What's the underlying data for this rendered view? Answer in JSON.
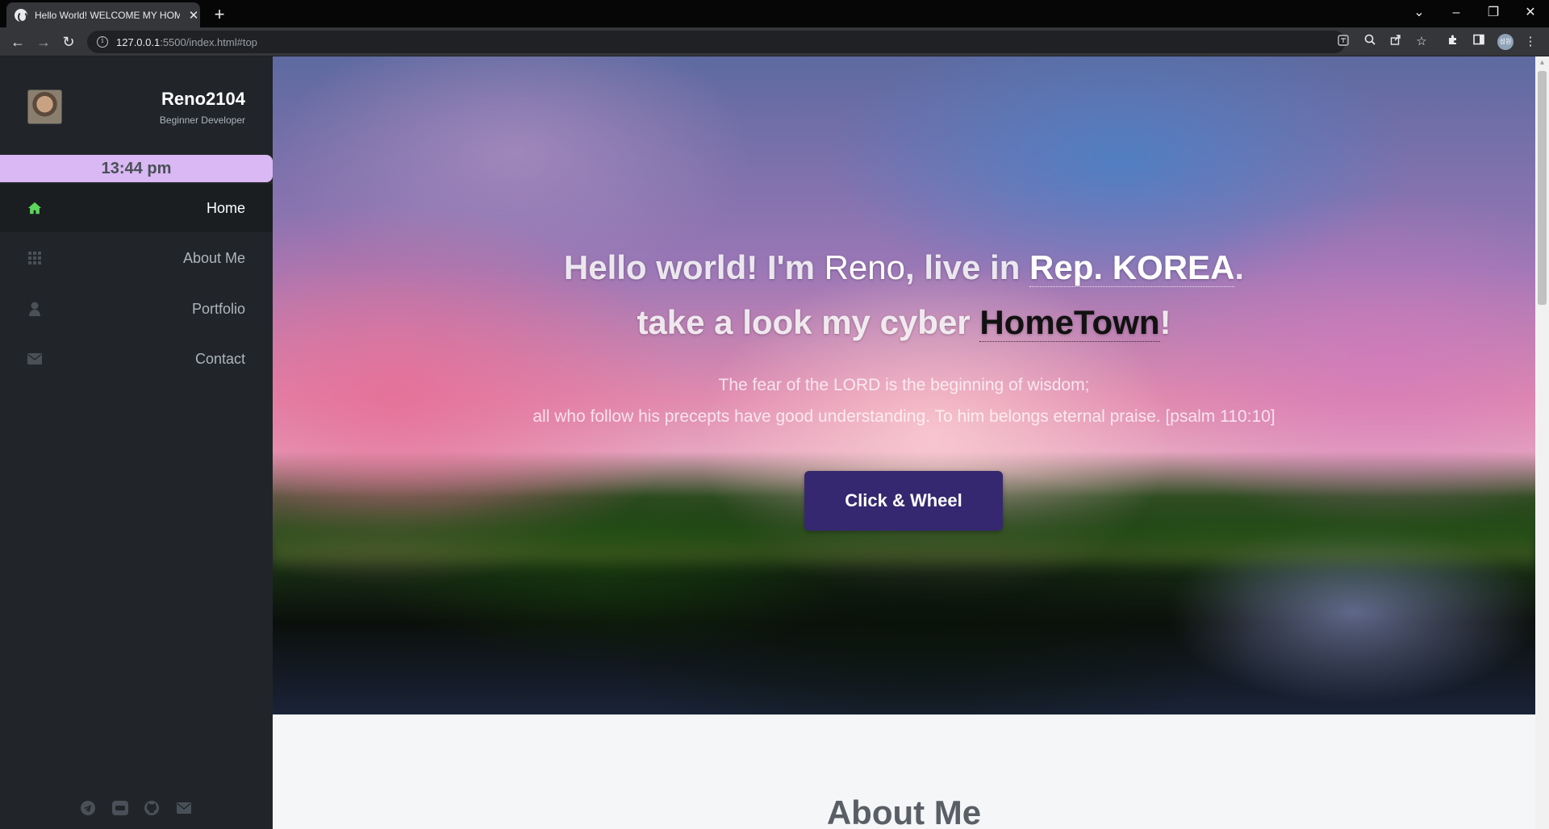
{
  "browser": {
    "tab_title": "Hello World! WELCOME MY HOME",
    "tab_close": "✕",
    "new_tab": "+",
    "url_host": "127.0.0.1",
    "url_rest": ":5500/index.html#top",
    "profile_initials": "성원"
  },
  "sidebar": {
    "name": "Reno2104",
    "role": "Beginner Developer",
    "clock": "13:44 pm",
    "menu": [
      {
        "label": "Home",
        "icon": "home-icon",
        "active": true
      },
      {
        "label": "About Me",
        "icon": "grid-icon",
        "active": false
      },
      {
        "label": "Portfolio",
        "icon": "user-icon",
        "active": false
      },
      {
        "label": "Contact",
        "icon": "envelope-icon",
        "active": false
      }
    ],
    "social": [
      "telegram-icon",
      "chat-icon",
      "github-icon",
      "mail-icon"
    ]
  },
  "hero": {
    "line1_a": "Hello world! I'm ",
    "line1_name": "Reno",
    "line1_b": ", live in ",
    "line1_country": "Rep. KOREA",
    "line1_c": ".",
    "line2_a": "take a look my cyber ",
    "line2_kw": "HomeTown",
    "line2_b": "!",
    "verse1": "The fear of the LORD is the beginning of wisdom;",
    "verse2": "all who follow his precepts have good understanding. To him belongs eternal praise. [psalm 110:10]",
    "button": "Click & Wheel"
  },
  "about": {
    "title": "About Me"
  },
  "colors": {
    "sidebar_bg": "#212529",
    "clock_bg": "#d9b8f3",
    "home_icon": "#5cd65c",
    "button_bg": "#352870"
  }
}
